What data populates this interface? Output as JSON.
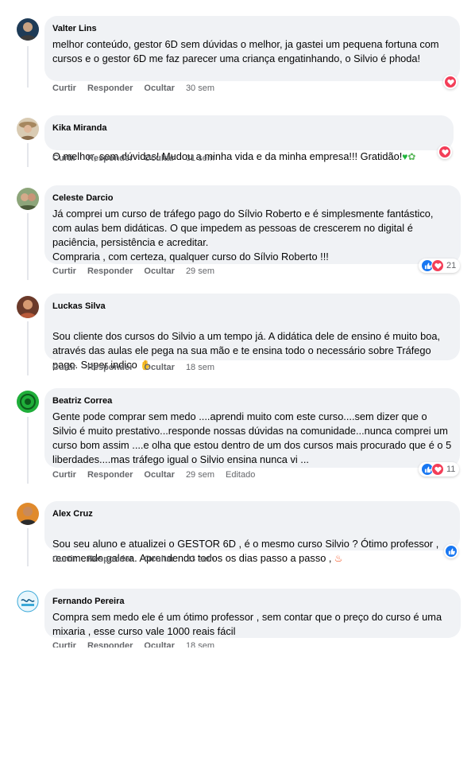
{
  "actions": {
    "like": "Curtir",
    "reply": "Responder",
    "hide": "Ocultar",
    "edited": "Editado"
  },
  "comments": [
    {
      "author": "Valter Lins",
      "text": "melhor conteúdo, gestor 6D sem dúvidas o melhor, ja gastei um pequena fortuna com cursos e o gestor 6D me faz parecer uma criança engatinhando, o Silvio é phoda!",
      "time": "30 sem",
      "reactions": [
        "love"
      ],
      "count": ""
    },
    {
      "author": "Kika Miranda",
      "text": "O melhor, sem dúvidas! Mudou a minha vida e da minha empresa!!! Gratidão!",
      "time": "31 sem",
      "reactions": [
        "love"
      ],
      "count": ""
    },
    {
      "author": "Celeste Darcio",
      "text": "Já comprei um curso de tráfego pago do Sílvio Roberto e é simplesmente fantástico, com aulas bem didáticas. O que impedem as pessoas de crescerem no digital é paciência, persistência e acreditar.\nCompraria , com certeza, qualquer curso do Sílvio Roberto !!!",
      "time": "29 sem",
      "reactions": [
        "like",
        "love"
      ],
      "count": "21"
    },
    {
      "author": "Luckas Silva",
      "text": "Sou cliente dos cursos do Silvio a um tempo já. A didática dele de ensino é muito boa, através das aulas ele pega na sua mão e te ensina todo o necessário sobre Tráfego pago. Super indico",
      "time": "18 sem",
      "reactions": [],
      "count": ""
    },
    {
      "author": "Beatriz Correa",
      "text": "Gente pode comprar sem medo ....aprendi muito com este curso....sem dizer que o Silvio é muito prestativo...responde nossas dúvidas na comunidade...nunca comprei um curso bom assim ....e olha que estou dentro de um dos cursos mais procurado que é o 5 liberdades....mas tráfego igual o Silvio ensina nunca vi ...",
      "time": "29 sem",
      "edited": true,
      "reactions": [
        "like",
        "love"
      ],
      "count": "11"
    },
    {
      "author": "Alex Cruz",
      "text": "Sou seu aluno e atualizei o GESTOR 6D , é o mesmo curso Silvio ? Ótimo professor , recomendo galera. Aprendendo todos os dias passo a passo ,",
      "time": "33 sem",
      "reactions": [
        "like"
      ],
      "count": ""
    },
    {
      "author": "Fernando Pereira",
      "text": "Compra sem medo ele é um ótimo professor , sem contar que o preço do curso é uma mixaria , esse curso vale 1000 reais fácil",
      "time": "18 sem",
      "reactions": [],
      "count": ""
    }
  ],
  "avatar_colors": [
    "#2f4f6f",
    "#b89b7a",
    "#6f8f5f",
    "#7a4a3a",
    "#1fae3a",
    "#c8791f",
    "#3aa8d8"
  ]
}
